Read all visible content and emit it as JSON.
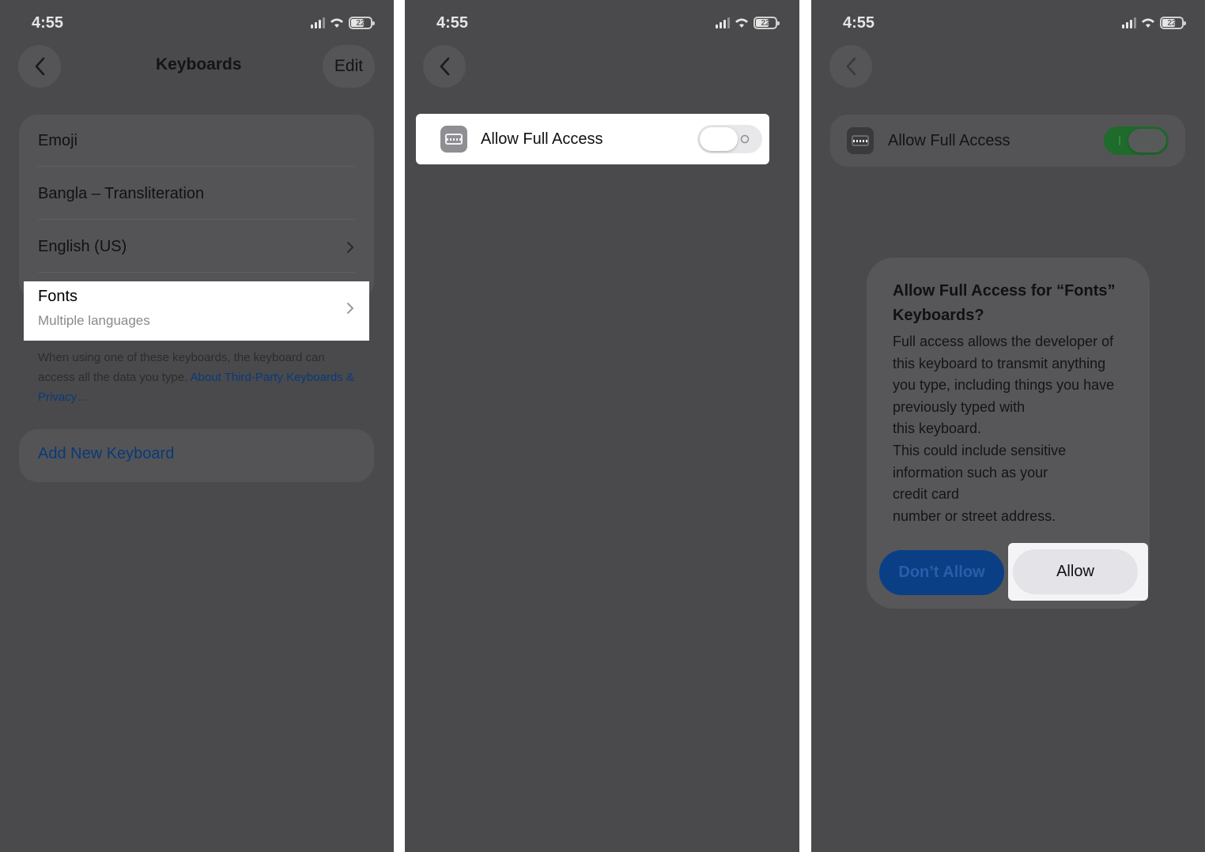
{
  "status_bar": {
    "time": "4:55",
    "battery": "22"
  },
  "panel1": {
    "nav_title": "Keyboards",
    "edit_label": "Edit",
    "keyboards": [
      "Emoji",
      "Bangla – Transliteration",
      "English (US)"
    ],
    "fonts_item": {
      "title": "Fonts",
      "subtitle": "Multiple languages"
    },
    "footnote_text": "When using one of these keyboards, the keyboard can access all the data you type. ",
    "footnote_link": "About Third-Party Keyboards & Privacy…",
    "add_keyboard": "Add New Keyboard"
  },
  "panel2": {
    "access_label": "Allow Full Access",
    "toggle_state": "off"
  },
  "panel3": {
    "access_label": "Allow Full Access",
    "toggle_state": "on",
    "alert": {
      "title": "Allow Full Access for “Fonts” Keyboards?",
      "body": "Full access allows the developer of this keyboard to transmit anything you type, including things you have previously typed with\nthis keyboard.\nThis could include sensitive information such as your\ncredit card\nnumber or street address.",
      "deny_label": "Don’t Allow",
      "allow_label": "Allow"
    }
  },
  "colors": {
    "dim_background": "#4a4a4c",
    "link_blue": "#0a3a78",
    "toggle_on": "#1e6b2c",
    "highlight": "#ffffff"
  }
}
